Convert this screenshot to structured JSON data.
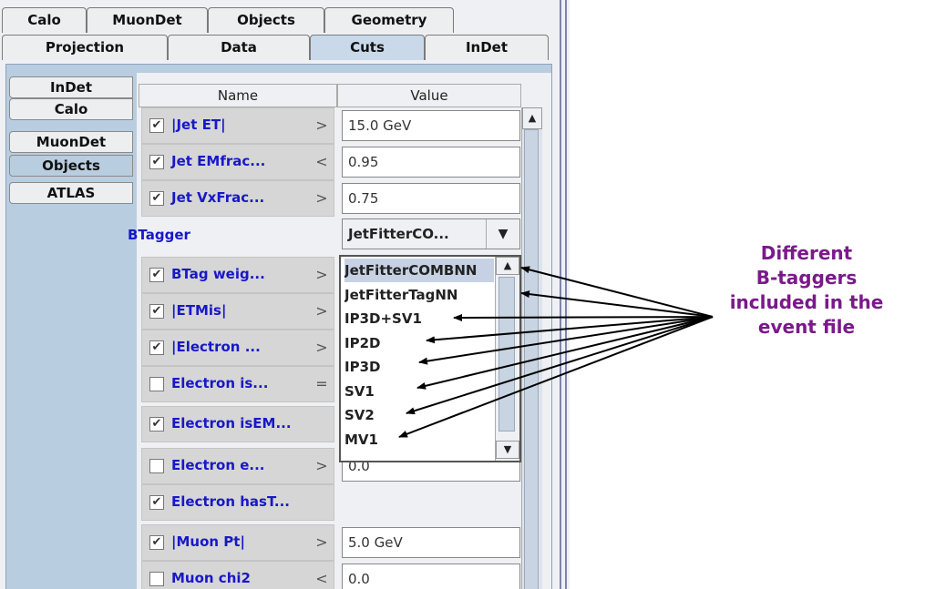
{
  "top_tabs_row1": [
    "Calo",
    "MuonDet",
    "Objects",
    "Geometry"
  ],
  "top_tabs_row2": [
    "Projection",
    "Data",
    "Cuts",
    "InDet"
  ],
  "side_tabs": [
    "InDet",
    "Calo",
    "MuonDet",
    "Objects",
    "ATLAS"
  ],
  "table": {
    "col_name": "Name",
    "col_value": "Value",
    "rows": [
      {
        "checked": true,
        "name": "|Jet ET|",
        "op": ">",
        "value": "15.0 GeV"
      },
      {
        "checked": true,
        "name": "Jet EMfrac...",
        "op": "<",
        "value": "0.95"
      },
      {
        "checked": true,
        "name": "Jet VxFrac...",
        "op": ">",
        "value": "0.75"
      },
      {
        "checked": null,
        "name": "BTagger",
        "op": "",
        "value": ""
      },
      {
        "checked": true,
        "name": "BTag weig...",
        "op": ">",
        "value": ""
      },
      {
        "checked": true,
        "name": "|ETMis|",
        "op": ">",
        "value": ""
      },
      {
        "checked": true,
        "name": "|Electron ...",
        "op": ">",
        "value": ""
      },
      {
        "checked": false,
        "name": "Electron is...",
        "op": "=",
        "value": ""
      },
      {
        "checked": true,
        "name": "Electron isEM...",
        "op": "",
        "value": ""
      },
      {
        "checked": false,
        "name": "Electron e...",
        "op": ">",
        "value": "0.0"
      },
      {
        "checked": true,
        "name": "Electron hasT...",
        "op": "",
        "value": ""
      },
      {
        "checked": true,
        "name": "|Muon Pt|",
        "op": ">",
        "value": "5.0 GeV"
      },
      {
        "checked": false,
        "name": "Muon chi2",
        "op": "<",
        "value": "0.0"
      }
    ]
  },
  "btagger_combo": {
    "value": "JetFitterCO..."
  },
  "btagger_options": [
    "JetFitterCOMBNN",
    "JetFitterTagNN",
    "IP3D+SV1",
    "IP2D",
    "IP3D",
    "SV1",
    "SV2",
    "MV1"
  ],
  "selected_option_index": 0,
  "annotation": {
    "lines": [
      "Different",
      "B-taggers",
      "included in the",
      "event file"
    ]
  },
  "colors": {
    "annotation": "#7a1a8a",
    "name_text": "#1818c8",
    "selected_tab": "#c9d9ea"
  }
}
